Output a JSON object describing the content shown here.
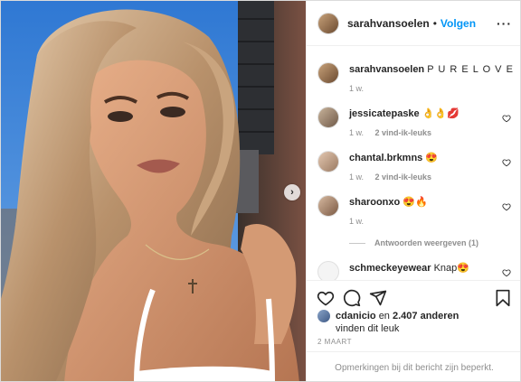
{
  "header": {
    "username": "sarahvansoelen",
    "separator": "•",
    "follow_label": "Volgen",
    "more_label": "···"
  },
  "caption": {
    "username": "sarahvansoelen",
    "text": "P U R E L O V E",
    "time": "1 w."
  },
  "comments": [
    {
      "username": "jessicatepaske",
      "text": "👌👌💋",
      "time": "1 w.",
      "likes": "2 vind-ik-leuks"
    },
    {
      "username": "chantal.brkmns",
      "text": "😍",
      "time": "1 w.",
      "likes": "2 vind-ik-leuks"
    },
    {
      "username": "sharoonxo",
      "text": "😍🔥",
      "time": "1 w.",
      "likes": ""
    },
    {
      "username": "schmeckeyewear",
      "text": "Knap😍",
      "time": "",
      "likes": ""
    }
  ],
  "replies_label": "Antwoorden weergeven (1)",
  "likes": {
    "user": "cdanicio",
    "connector": "en",
    "count": "2.407 anderen",
    "suffix": "vinden dit leuk"
  },
  "date": "2 MAART",
  "comments_restricted": "Opmerkingen bij dit bericht zijn beperkt.",
  "colors": {
    "accent": "#0095f6",
    "muted": "#8e8e8e",
    "text": "#262626"
  },
  "icons": [
    "heart-icon",
    "comment-icon",
    "share-icon",
    "bookmark-icon",
    "chevron-right-icon",
    "more-icon"
  ]
}
